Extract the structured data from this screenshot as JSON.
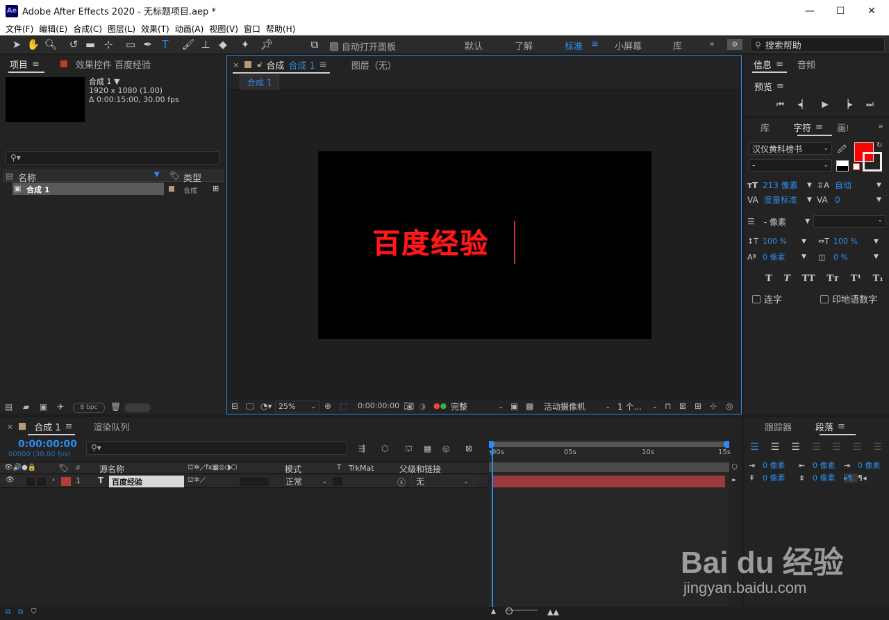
{
  "app": {
    "title": "Adobe After Effects 2020 - 无标题项目.aep *",
    "logo": "Ae"
  },
  "menu": [
    "文件(F)",
    "编辑(E)",
    "合成(C)",
    "图层(L)",
    "效果(T)",
    "动画(A)",
    "视图(V)",
    "窗口",
    "帮助(H)"
  ],
  "toolbar": {
    "auto_open_label": "自动打开面板",
    "workspaces": [
      "默认",
      "了解",
      "标准",
      "小屏幕",
      "库"
    ],
    "active_workspace": "标准",
    "search_placeholder": "搜索帮助"
  },
  "project": {
    "tab_project": "项目",
    "tab_effects": "效果控件 百度经验",
    "comp_name": "合成 1",
    "comp_dims": "1920 x 1080 (1.00)",
    "comp_duration": "Δ 0:00:15:00, 30.00 fps",
    "col_name": "名称",
    "col_type": "类型",
    "item_name": "合成 1",
    "item_type": "合成",
    "bpc": "8 bpc"
  },
  "composition": {
    "tab_label": "合成",
    "tab_name": "合成 1",
    "layer_tab": "图层（无）",
    "breadcrumb": "合成 1",
    "text": "百度经验",
    "text_color": "#ff1a1a",
    "zoom": "25%",
    "timecode": "0:00:00:00",
    "resolution": "完整",
    "camera": "活动摄像机",
    "views": "1 个..."
  },
  "info": {
    "tab_info": "信息",
    "tab_audio": "音频",
    "preview": "预览"
  },
  "character": {
    "tab_library": "库",
    "tab_character": "字符",
    "tab_paragraph": "画̈",
    "font_family": "汉仪黄科榜书",
    "font_style": "-",
    "fill_color": "#ff0000",
    "font_size": "213 像素",
    "leading": "自动",
    "kerning": "度量标准",
    "tracking": "0",
    "stroke_width": "- 像素",
    "vscale": "100 %",
    "hscale": "100 %",
    "baseline": "0 像素",
    "tsume": "0 %",
    "styles": [
      "T",
      "T",
      "TT",
      "Tт",
      "T¹",
      "T₁"
    ],
    "ligatures": "连字",
    "hindi_digits": "印地语数字"
  },
  "timeline": {
    "tab_comp": "合成 1",
    "tab_render": "渲染队列",
    "timecode": "0:00:00:00",
    "frame_info": "00000 (30.00 fps)",
    "col_source": "源名称",
    "col_mode": "模式",
    "col_t": "T",
    "col_trkmat": "TrkMat",
    "col_parent": "父级和链接",
    "layer_index": "1",
    "layer_type": "T",
    "layer_name": "百度经验",
    "layer_mode": "正常",
    "layer_parent": "无",
    "layer_color": "#b53a3a",
    "ticks": [
      "00s",
      "05s",
      "10s",
      "15s"
    ]
  },
  "tracker": {
    "tab_tracker": "跟踪器",
    "tab_paragraph": "段落",
    "indent_left": "0 像素",
    "indent_right": "0 像素",
    "indent_first": "0 像素",
    "space_before": "0 像素",
    "space_after": "0 像素"
  },
  "watermark": {
    "logo": "Bai du 经验",
    "url": "jingyan.baidu.com"
  }
}
